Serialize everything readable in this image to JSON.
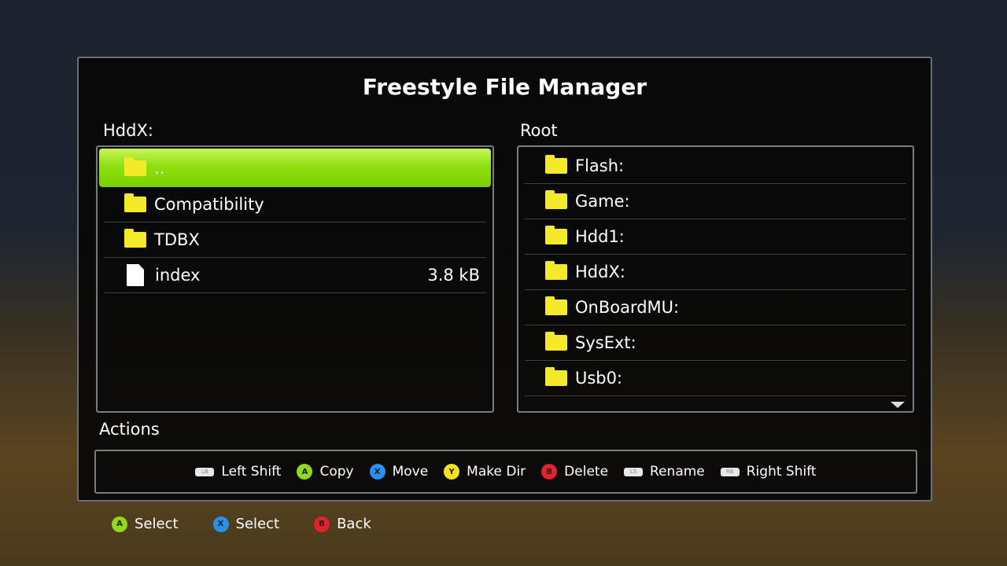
{
  "title": "Freestyle File Manager",
  "left_panel": {
    "label": "HddX:",
    "items": [
      {
        "name": "..",
        "type": "folder",
        "size": "",
        "selected": true
      },
      {
        "name": "Compatibility",
        "type": "folder",
        "size": ""
      },
      {
        "name": "TDBX",
        "type": "folder",
        "size": ""
      },
      {
        "name": "index",
        "type": "file",
        "size": "3.8 kB"
      }
    ]
  },
  "right_panel": {
    "label": "Root",
    "items": [
      {
        "name": "Flash:"
      },
      {
        "name": "Game:"
      },
      {
        "name": "Hdd1:"
      },
      {
        "name": "HddX:"
      },
      {
        "name": "OnBoardMU:"
      },
      {
        "name": "SysExt:"
      },
      {
        "name": "Usb0:"
      }
    ]
  },
  "actions": {
    "label": "Actions",
    "items": [
      {
        "button": "LB",
        "label": "Left Shift",
        "color": "#e8e8e8"
      },
      {
        "button": "A",
        "label": "Copy",
        "color": "#8fd81c"
      },
      {
        "button": "X",
        "label": "Move",
        "color": "#2a8ff0"
      },
      {
        "button": "Y",
        "label": "Make Dir",
        "color": "#f3e21a"
      },
      {
        "button": "B",
        "label": "Delete",
        "color": "#e0232c"
      },
      {
        "button": "LS",
        "label": "Rename",
        "color": "#e8e8e8"
      },
      {
        "button": "RB",
        "label": "Right Shift",
        "color": "#e8e8e8"
      }
    ]
  },
  "footer": [
    {
      "button": "A",
      "label": "Select",
      "color": "#8fd81c"
    },
    {
      "button": "X",
      "label": "Select",
      "color": "#2a8ff0"
    },
    {
      "button": "B",
      "label": "Back",
      "color": "#e0232c"
    }
  ],
  "colors": {
    "selection": "#8fe010",
    "folder": "#f4ea2a"
  }
}
